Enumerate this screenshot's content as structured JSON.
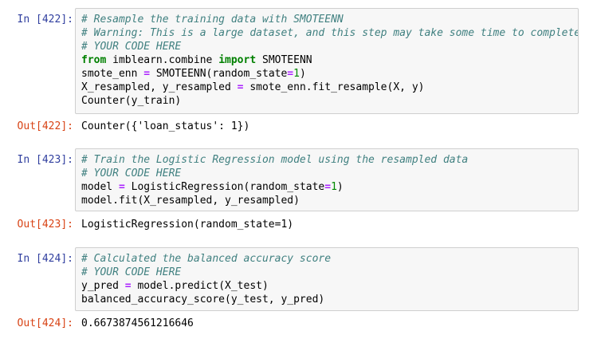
{
  "cells": [
    {
      "in_prompt": "In [422]:",
      "out_prompt": "Out[422]:",
      "output": "Counter({'loan_status': 1})",
      "code": {
        "c1": "# Resample the training data with SMOTEENN",
        "c2": "# Warning: This is a large dataset, and this step may take some time to complete",
        "c3": "# YOUR CODE HERE",
        "l4_kw1": "from",
        "l4_mid": " imblearn.combine ",
        "l4_kw2": "import",
        "l4_end": " SMOTEENN",
        "l5_a": "smote_enn ",
        "l5_eq": "=",
        "l5_b": " SMOTEENN(random_state",
        "l5_eq2": "=",
        "l5_num": "1",
        "l5_c": ")",
        "l6_a": "X_resampled, y_resampled ",
        "l6_eq": "=",
        "l6_b": " smote_enn.fit_resample(X, y)",
        "l7": "Counter(y_train)"
      }
    },
    {
      "in_prompt": "In [423]:",
      "out_prompt": "Out[423]:",
      "output": "LogisticRegression(random_state=1)",
      "code": {
        "c1": "# Train the Logistic Regression model using the resampled data",
        "c2": "# YOUR CODE HERE",
        "l3_a": "model ",
        "l3_eq": "=",
        "l3_b": " LogisticRegression(random_state",
        "l3_eq2": "=",
        "l3_num": "1",
        "l3_c": ")",
        "l4": "model.fit(X_resampled, y_resampled)"
      }
    },
    {
      "in_prompt": "In [424]:",
      "out_prompt": "Out[424]:",
      "output": "0.6673874561216646",
      "code": {
        "c1": "# Calculated the balanced accuracy score",
        "c2": "# YOUR CODE HERE",
        "l3_a": "y_pred ",
        "l3_eq": "=",
        "l3_b": " model.predict(X_test)",
        "l4": "balanced_accuracy_score(y_test, y_pred)"
      }
    }
  ]
}
